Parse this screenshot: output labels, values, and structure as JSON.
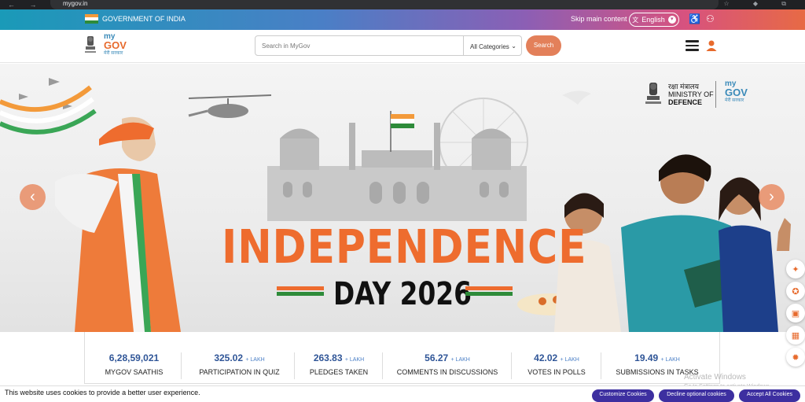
{
  "browser": {
    "url": "mygov.in",
    "nav_glyphs": "← → ✕",
    "right_glyphs": "☆ ◆ ⧉"
  },
  "gov_strip": {
    "label": "GOVERNMENT OF INDIA",
    "skip_link": "Skip main content",
    "language": "English"
  },
  "header": {
    "logo_my": "my",
    "logo_gov": "GOV",
    "logo_hindi": "मेरी सरकार",
    "search_placeholder": "Search in MyGov",
    "category": "All Categories",
    "search_button": "Search"
  },
  "hero": {
    "title": "INDEPENDENCE",
    "subtitle": "DAY 2026",
    "mod_hindi": "रक्षा मंत्रालय",
    "mod_line1": "MINISTRY OF",
    "mod_line2": "DEFENCE",
    "prev_arrow": "‹",
    "next_arrow": "›"
  },
  "stats": [
    {
      "value": "6,28,59,021",
      "unit": "",
      "label": "MYGOV SAATHIS"
    },
    {
      "value": "325.02",
      "unit": "+ LAKH",
      "label": "PARTICIPATION IN QUIZ"
    },
    {
      "value": "263.83",
      "unit": "+ LAKH",
      "label": "PLEDGES TAKEN"
    },
    {
      "value": "56.27",
      "unit": "+ LAKH",
      "label": "COMMENTS IN DISCUSSIONS"
    },
    {
      "value": "42.02",
      "unit": "+ LAKH",
      "label": "VOTES IN POLLS"
    },
    {
      "value": "19.49",
      "unit": "+ LAKH",
      "label": "SUBMISSIONS IN TASKS"
    }
  ],
  "watermark": {
    "line1": "Activate Windows",
    "line2": "Go to Settings to activate Windows."
  },
  "cookie": {
    "text": "This website uses cookies to provide a better user experience.",
    "customize": "Customize Cookies",
    "decline": "Decline optional cookies",
    "accept": "Accept All Cookies"
  },
  "colors": {
    "saffron": "#ee6c2e",
    "green": "#2e8b3a",
    "navy": "#2f5597",
    "cookie_button": "#3d2fa0"
  }
}
